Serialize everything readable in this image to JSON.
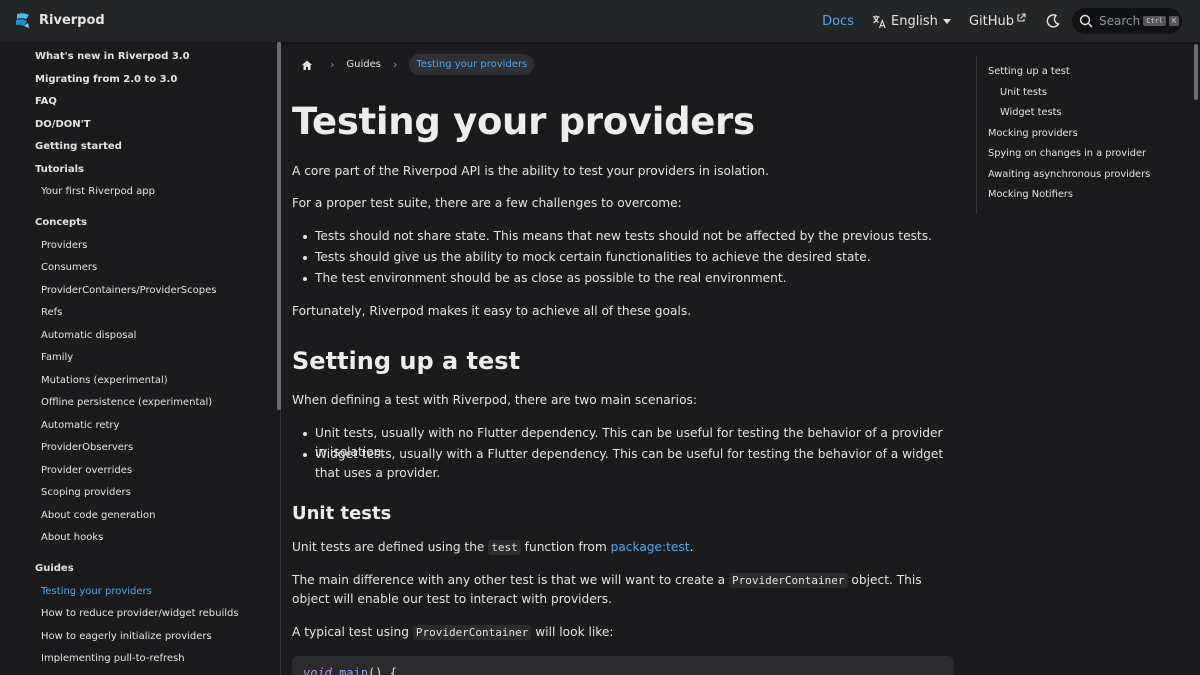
{
  "navbar": {
    "brand": "Riverpod",
    "docs": "Docs",
    "language": "English",
    "github": "GitHub",
    "search_placeholder": "Search",
    "kbd_ctrl": "Ctrl",
    "kbd_k": "K",
    "accent": "#4ea7e8"
  },
  "sidebar": {
    "items": [
      {
        "label": "What's new in Riverpod 3.0"
      },
      {
        "label": "Migrating from 2.0 to 3.0"
      },
      {
        "label": "FAQ"
      },
      {
        "label": "DO/DON'T"
      },
      {
        "label": "Getting started"
      },
      {
        "label": "Tutorials"
      },
      {
        "label": "Your first Riverpod app"
      },
      {
        "label": "Concepts"
      },
      {
        "label": "Providers"
      },
      {
        "label": "Consumers"
      },
      {
        "label": "ProviderContainers/ProviderScopes"
      },
      {
        "label": "Refs"
      },
      {
        "label": "Automatic disposal"
      },
      {
        "label": "Family"
      },
      {
        "label": "Mutations (experimental)"
      },
      {
        "label": "Offline persistence (experimental)"
      },
      {
        "label": "Automatic retry"
      },
      {
        "label": "ProviderObservers"
      },
      {
        "label": "Provider overrides"
      },
      {
        "label": "Scoping providers"
      },
      {
        "label": "About code generation"
      },
      {
        "label": "About hooks"
      },
      {
        "label": "Guides"
      },
      {
        "label": "Testing your providers"
      },
      {
        "label": "How to reduce provider/widget rebuilds"
      },
      {
        "label": "How to eagerly initialize providers"
      },
      {
        "label": "Implementing pull-to-refresh"
      }
    ]
  },
  "breadcrumb": {
    "section": "Guides",
    "current": "Testing your providers"
  },
  "article": {
    "title": "Testing your providers",
    "intro": "A core part of the Riverpod API is the ability to test your providers in isolation.",
    "challenges_lead": "For a proper test suite, there are a few challenges to overcome:",
    "challenges": [
      "Tests should not share state. This means that new tests should not be affected by the previous tests.",
      "Tests should give us the ability to mock certain functionalities to achieve the desired state.",
      "The test environment should be as close as possible to the real environment."
    ],
    "fortunately": "Fortunately, Riverpod makes it easy to achieve all of these goals.",
    "setup_heading": "Setting up a test",
    "scenarios_lead": "When defining a test with Riverpod, there are two main scenarios:",
    "scenarios": [
      "Unit tests, usually with no Flutter dependency. This can be useful for testing the behavior of a provider in isolation.",
      "Widget tests, usually with a Flutter dependency. This can be useful for testing the behavior of a widget that uses a provider."
    ],
    "unit_heading": "Unit tests",
    "unit_p1_a": "Unit tests are defined using the ",
    "unit_p1_code": "test",
    "unit_p1_b": " function from ",
    "unit_p1_link": "package:test",
    "unit_p1_c": ".",
    "unit_p2_a": "The main difference with any other test is that we will want to create a ",
    "unit_p2_code": "ProviderContainer",
    "unit_p2_b": " object. This object will enable our test to interact with providers.",
    "unit_p3_a": "A typical test using ",
    "unit_p3_code": "ProviderContainer",
    "unit_p3_b": " will look like:",
    "code_kw": "void",
    "code_fn": "main",
    "code_rest": "() {"
  },
  "toc": {
    "items": [
      {
        "label": "Setting up a test"
      },
      {
        "label": "Unit tests"
      },
      {
        "label": "Widget tests"
      },
      {
        "label": "Mocking providers"
      },
      {
        "label": "Spying on changes in a provider"
      },
      {
        "label": "Awaiting asynchronous providers"
      },
      {
        "label": "Mocking Notifiers"
      }
    ]
  }
}
